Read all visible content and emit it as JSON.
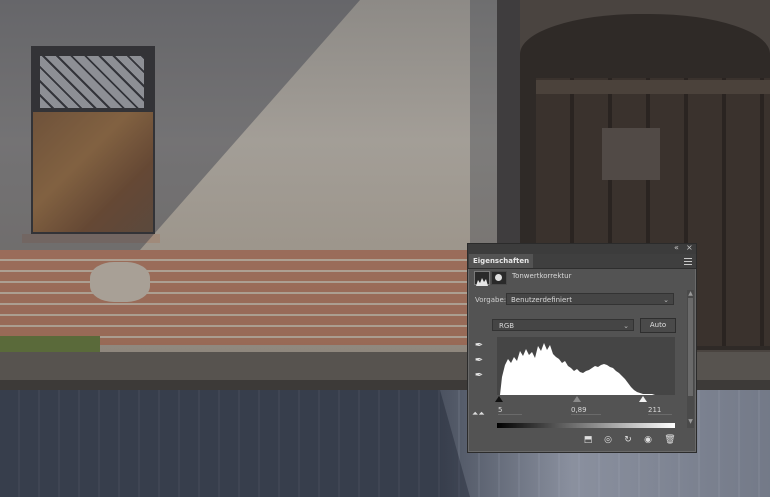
{
  "panel": {
    "collapse_icon": "«",
    "close_icon": "×",
    "tab_label": "Eigenschaften",
    "adjustment_title": "Tonwertkorrektur",
    "preset_label": "Vorgabe:",
    "preset_value": "Benutzerdefiniert",
    "channel_value": "RGB",
    "auto_label": "Auto",
    "input_black": "5",
    "input_gamma": "0,89",
    "input_white": "211",
    "icons": [
      "levels-icon",
      "mask-icon",
      "black-point-eyedropper-icon",
      "gray-point-eyedropper-icon",
      "white-point-eyedropper-icon",
      "clip-to-layer-icon",
      "view-previous-icon",
      "reset-icon",
      "visibility-eye-icon",
      "trash-icon"
    ]
  },
  "histogram_data": {
    "levels_input": {
      "black": 5,
      "gamma": 0.89,
      "white": 211
    },
    "colors": {
      "fill": "#ffffff",
      "background": "#454545"
    }
  }
}
